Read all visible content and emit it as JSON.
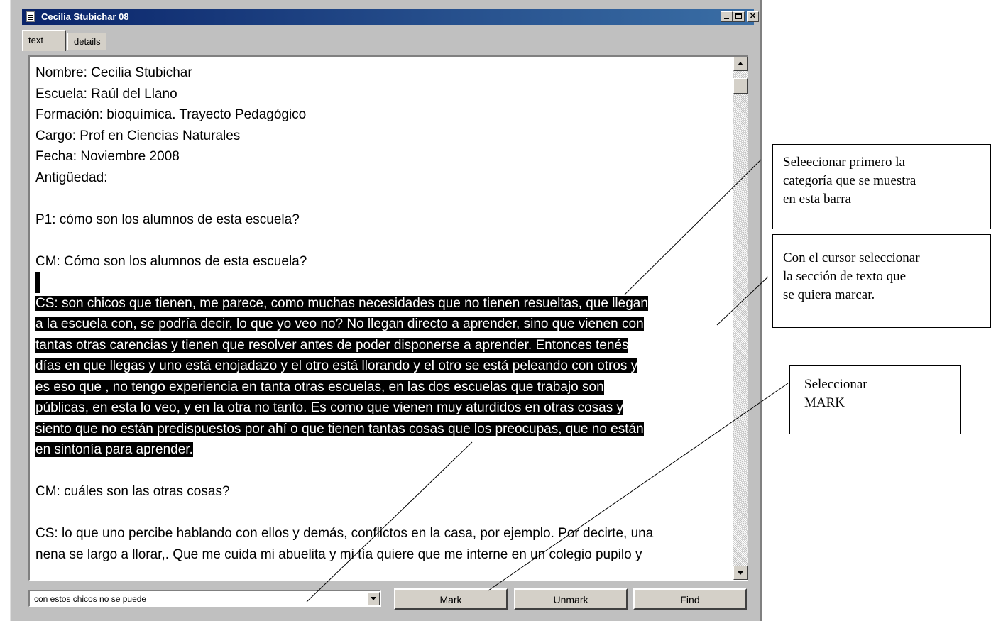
{
  "window": {
    "title": "Cecilia Stubichar 08",
    "controls": [
      "minimize",
      "maximize",
      "close"
    ]
  },
  "tabs": [
    {
      "label": "text",
      "active": true
    },
    {
      "label": "details",
      "active": false
    }
  ],
  "document": {
    "lines": [
      {
        "text": "Nombre: Cecilia Stubichar",
        "selected": false
      },
      {
        "text": "Escuela: Raúl del Llano",
        "selected": false
      },
      {
        "text": "Formación: bioquímica. Trayecto Pedagógico",
        "selected": false
      },
      {
        "text": "Cargo: Prof en Ciencias Naturales",
        "selected": false
      },
      {
        "text": "Fecha: Noviembre 2008",
        "selected": false
      },
      {
        "text": "Antigüedad:",
        "selected": false
      },
      {
        "text": "",
        "selected": false
      },
      {
        "text": "P1: cómo son los alumnos de esta escuela?",
        "selected": false
      },
      {
        "text": "",
        "selected": false
      },
      {
        "text": "CM: Cómo son los alumnos de esta escuela?",
        "selected": false
      },
      {
        "text": "",
        "selected": true
      },
      {
        "text": "CS: son chicos que tienen, me parece, como muchas necesidades que no tienen resueltas, que llegan",
        "selected": true
      },
      {
        "text": "a la escuela con, se podría decir, lo que yo veo no? No llegan directo a aprender, sino que vienen con",
        "selected": true
      },
      {
        "text": "tantas otras carencias y tienen que resolver antes de poder disponerse a aprender. Entonces tenés",
        "selected": true
      },
      {
        "text": "días en que llegas y uno está enojadazo y el otro está llorando y el otro se está peleando con otros y",
        "selected": true
      },
      {
        "text": "es eso que , no tengo experiencia en tanta otras escuelas, en las dos escuelas que trabajo son",
        "selected": true
      },
      {
        "text": "públicas, en esta lo veo, y en la otra no tanto. Es como que vienen muy aturdidos en otras cosas y",
        "selected": true
      },
      {
        "text": "siento que no están predispuestos por ahí o que tienen tantas cosas que los preocupas, que no están",
        "selected": true
      },
      {
        "text": "en sintonía para aprender.",
        "selected": true
      },
      {
        "text": "",
        "selected": false
      },
      {
        "text": "CM: cuáles son las otras cosas?",
        "selected": false
      },
      {
        "text": "",
        "selected": false
      },
      {
        "text": "CS: lo que uno percibe hablando con ellos y demás, conflictos en la casa, por ejemplo. Por decirte, una",
        "selected": false
      },
      {
        "text": "nena se largo a llorar,. Que me cuida mi abuelita y mi tía quiere que me interne en un colegio pupilo y",
        "selected": false
      }
    ]
  },
  "toolbar": {
    "category_value": "con estos chicos no se puede",
    "mark_label": "Mark",
    "unmark_label": "Unmark",
    "find_label": "Find"
  },
  "callouts": [
    {
      "lines": [
        "Seleecionar primero la",
        "categoría que se muestra",
        "en esta barra"
      ]
    },
    {
      "lines": [
        "Con el cursor seleccionar",
        "la sección de texto que",
        "se quiera marcar."
      ]
    },
    {
      "lines": [
        "Seleccionar",
        "MARK"
      ]
    }
  ],
  "colors": {
    "titlebar_start": "#0a246a",
    "titlebar_end": "#3a6ea5",
    "selection": "#000000",
    "window_bg": "#c0c0c0"
  }
}
